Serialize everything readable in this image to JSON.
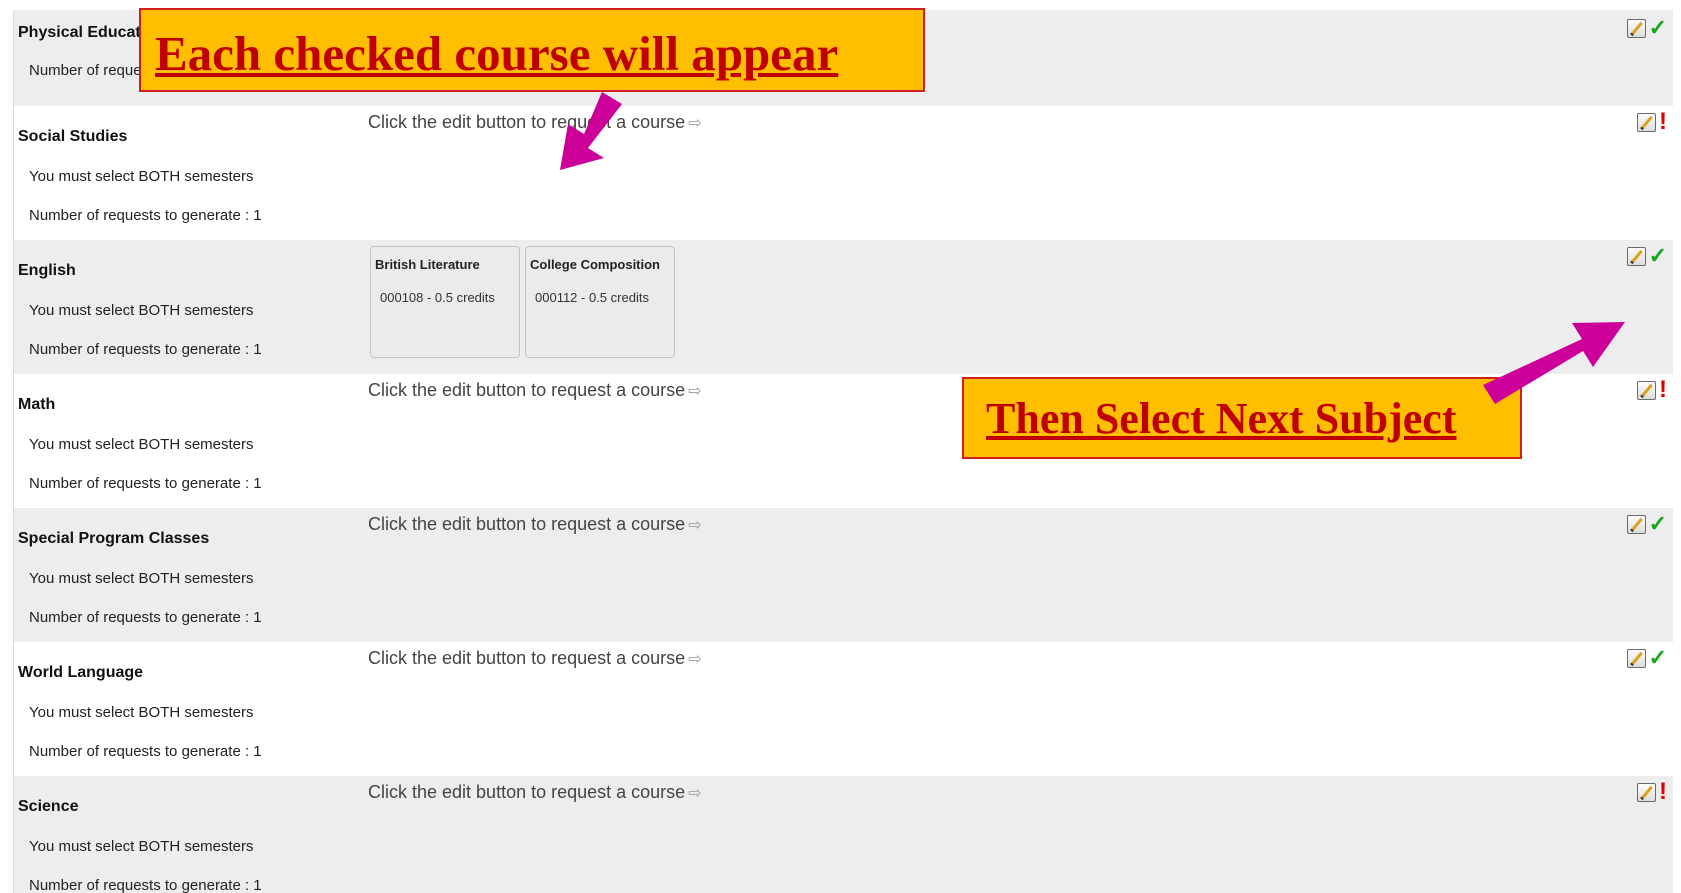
{
  "edit_hint": "Click the edit button to request a course",
  "hint_arrow_icon": "arrow-right-icon",
  "semesters_note": "You must select BOTH semesters",
  "subjects": [
    {
      "name": "Physical Education",
      "requests": "Number of requests to generate : 1",
      "status": "complete"
    },
    {
      "name": "Social Studies",
      "note": "You must select BOTH semesters",
      "requests": "Number of requests to generate : 1",
      "hint": "Click the edit button to request a course",
      "status": "incomplete"
    },
    {
      "name": "English",
      "note": "You must select BOTH semesters",
      "requests": "Number of requests to generate : 1",
      "status": "complete",
      "courses": [
        {
          "name": "British Literature",
          "code": "000108 - 0.5 credits"
        },
        {
          "name": "College Composition",
          "code": "000112 - 0.5 credits"
        }
      ]
    },
    {
      "name": "Math",
      "note": "You must select BOTH semesters",
      "requests": "Number of requests to generate : 1",
      "hint": "Click the edit button to request a course",
      "status": "incomplete"
    },
    {
      "name": "Special Program Classes",
      "note": "You must select BOTH semesters",
      "requests": "Number of requests to generate : 1",
      "hint": "Click the edit button to request a course",
      "status": "complete"
    },
    {
      "name": "World Language",
      "note": "You must select BOTH semesters",
      "requests": "Number of requests to generate : 1",
      "hint": "Click the edit button to request a course",
      "status": "complete"
    },
    {
      "name": "Science",
      "note": "You must select BOTH semesters",
      "requests": "Number of requests to generate : 1",
      "hint": "Click the edit button to request a course",
      "status": "incomplete"
    }
  ],
  "icons": {
    "edit": "edit-pencil-icon",
    "complete": "checkmark-icon",
    "incomplete": "exclamation-icon"
  },
  "annotations": {
    "top_callout": "Each checked course will appear",
    "next_callout": "Then Select Next Subject"
  },
  "colors": {
    "callout_bg": "#ffbf00",
    "callout_text": "#c00000",
    "callout_border": "#d11e1e",
    "pointer_arrow": "#cc0099",
    "check": "#16a51e",
    "alert": "#e00000",
    "row_shaded": "#ededed"
  }
}
